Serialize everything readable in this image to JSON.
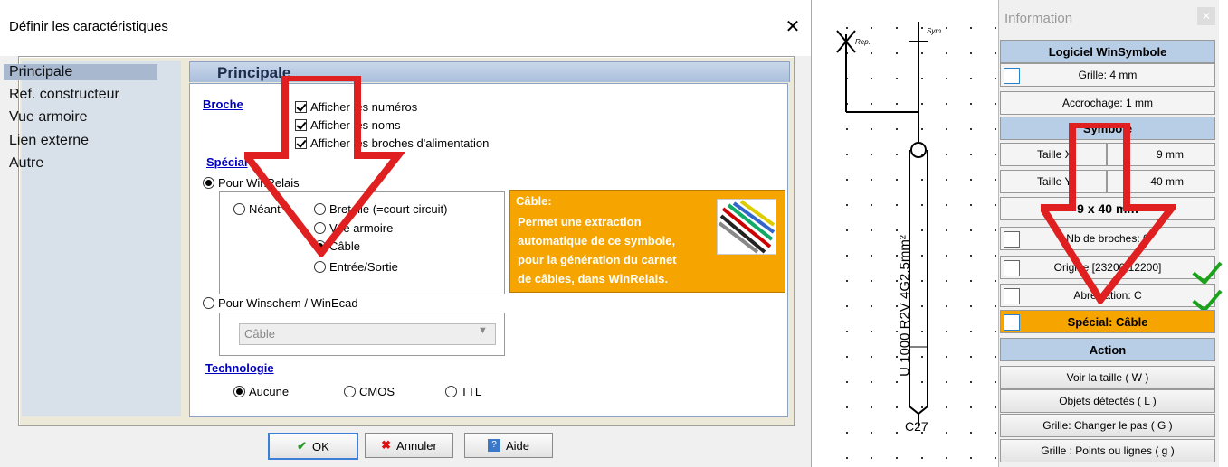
{
  "dialog": {
    "title": "Définir les caractéristiques",
    "close_glyph": "✕",
    "nav": [
      "Principale",
      "Ref. constructeur",
      "Vue armoire",
      "Lien externe",
      "Autre"
    ],
    "selected_nav": "Principale",
    "panel_title": "Principale",
    "broche": {
      "title": "Broche",
      "options": [
        {
          "label": "Afficher les numéros",
          "checked": true
        },
        {
          "label": "Afficher les noms",
          "checked": true
        },
        {
          "label": "Afficher les broches d'alimentation",
          "checked": true
        }
      ]
    },
    "special": {
      "title": "Spécial",
      "pour_winrelais": "Pour WinRelais",
      "neant": "Néant",
      "bretelle": "Bretelle (=court circuit)",
      "vue_armoire": "Vue armoire",
      "cable": "Câble",
      "entree_sortie": "Entrée/Sortie",
      "pour_winschem": "Pour Winschem / WinEcad",
      "select_value": "Câble"
    },
    "info_box": {
      "title": "Câble:",
      "lines": [
        "Permet une extraction",
        "automatique de ce symbole,",
        "pour la génération du carnet",
        "de câbles, dans WinRelais."
      ],
      "image_icon": "cable-bundle-icon",
      "color": "#f5a400"
    },
    "technologie": {
      "title": "Technologie",
      "options": [
        {
          "label": "Aucune",
          "checked": true
        },
        {
          "label": "CMOS",
          "checked": false
        },
        {
          "label": "TTL",
          "checked": false
        }
      ]
    },
    "buttons": {
      "ok": "OK",
      "annuler": "Annuler",
      "aide": "Aide"
    }
  },
  "canvas": {
    "rep_label": "Rep.",
    "sym_label": "Sym.",
    "cable_text": "U 1000 R2V 4G2.5mm²",
    "bottom_label": "C27"
  },
  "info_panel": {
    "title": "Information",
    "logiciel": "Logiciel WinSymbole",
    "grille": "Grille: 4 mm",
    "accrochage": "Accrochage: 1 mm",
    "symbole": "Symbole",
    "taille_x_label": "Taille X",
    "taille_x_value": "9 mm",
    "taille_y_label": "Taille Y",
    "taille_y_value": "40 mm",
    "taille_summary": "9 x 40 mm",
    "nb_broches": "Nb de broches: 0",
    "origine": "Origine [23200,12200]",
    "abreviation": "Abréviation: C",
    "special": "Spécial: Câble",
    "action": "Action",
    "actions": [
      "Voir la taille ( W )",
      "Objets détectés ( L )",
      "Grille: Changer le pas ( G )",
      "Grille : Points ou lignes ( g )"
    ],
    "accent_blue": "#b8cde6",
    "accent_orange": "#f5a400"
  }
}
